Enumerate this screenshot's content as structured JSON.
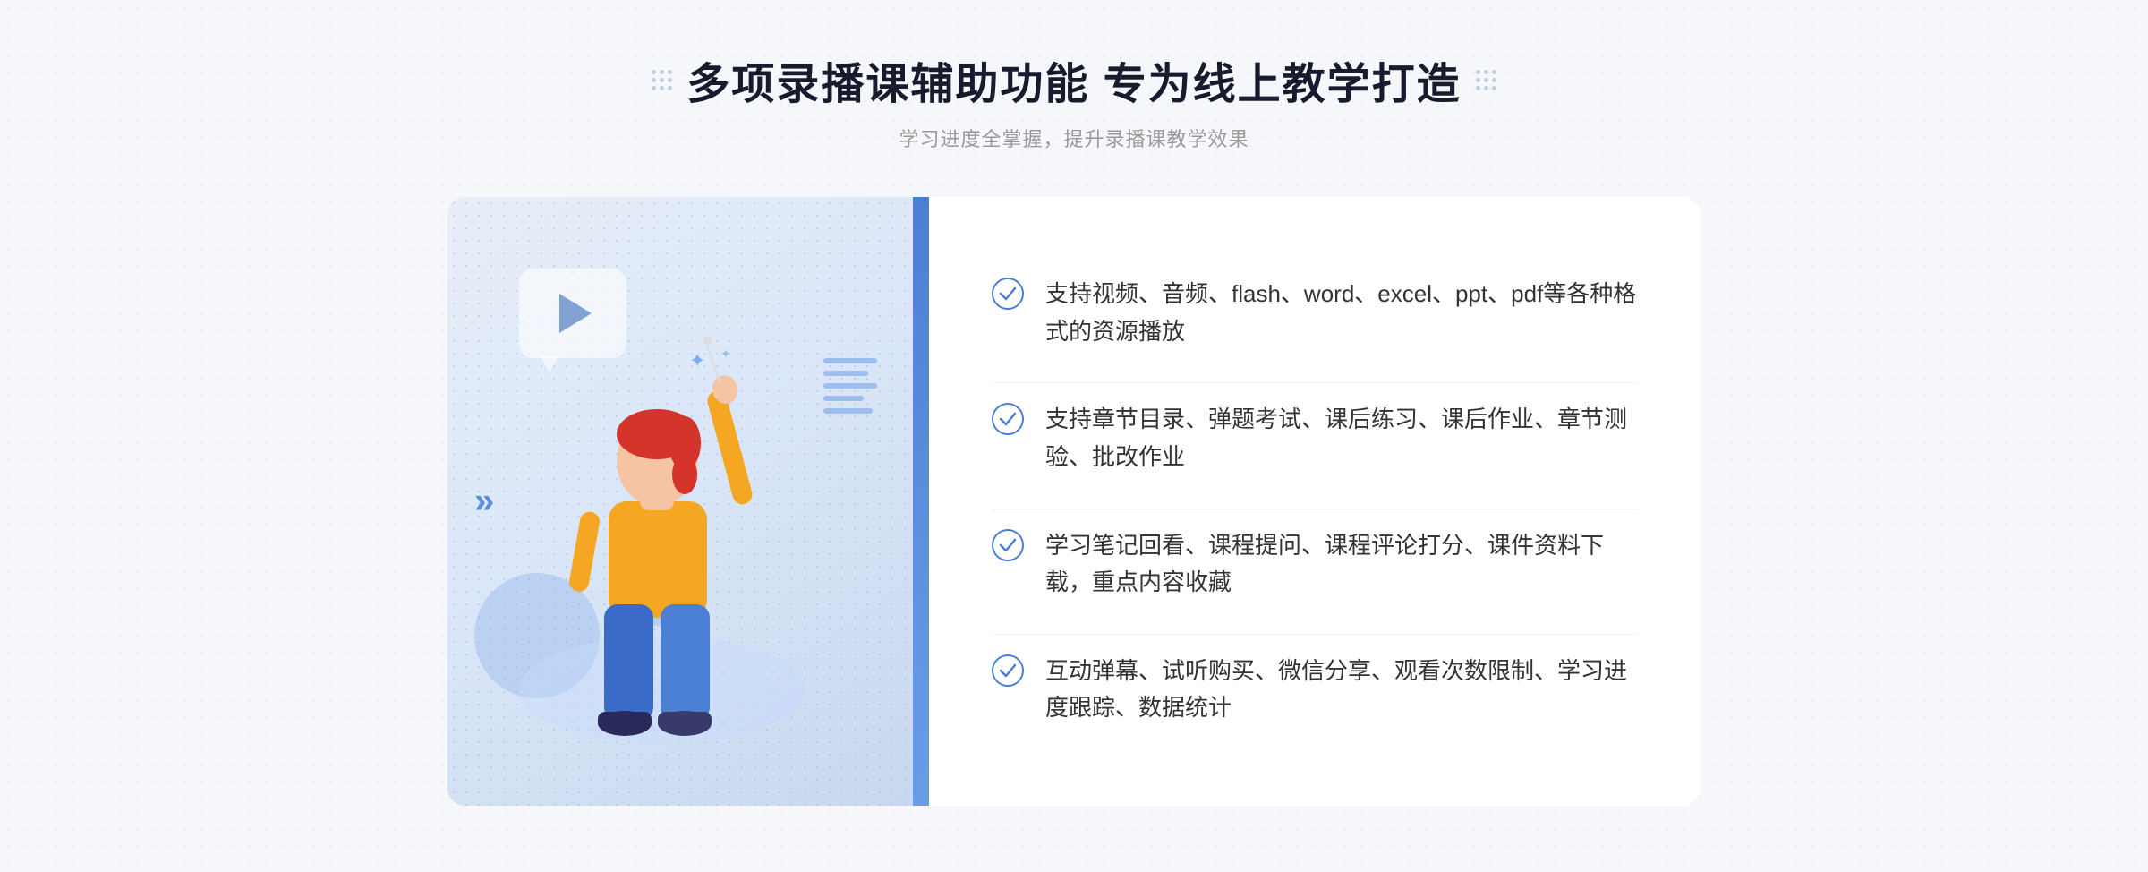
{
  "header": {
    "title": "多项录播课辅助功能 专为线上教学打造",
    "subtitle": "学习进度全掌握，提升录播课教学效果"
  },
  "features": [
    {
      "id": 1,
      "text": "支持视频、音频、flash、word、excel、ppt、pdf等各种格式的资源播放"
    },
    {
      "id": 2,
      "text": "支持章节目录、弹题考试、课后练习、课后作业、章节测验、批改作业"
    },
    {
      "id": 3,
      "text": "学习笔记回看、课程提问、课程评论打分、课件资料下载，重点内容收藏"
    },
    {
      "id": 4,
      "text": "互动弹幕、试听购买、微信分享、观看次数限制、学习进度跟踪、数据统计"
    }
  ],
  "icons": {
    "check": "✓",
    "chevron_left": "«",
    "play": "▶"
  },
  "colors": {
    "primary": "#4a7fd4",
    "title": "#1a1a2e",
    "subtitle": "#999999",
    "text": "#333333",
    "accent": "#5b8dd9"
  }
}
